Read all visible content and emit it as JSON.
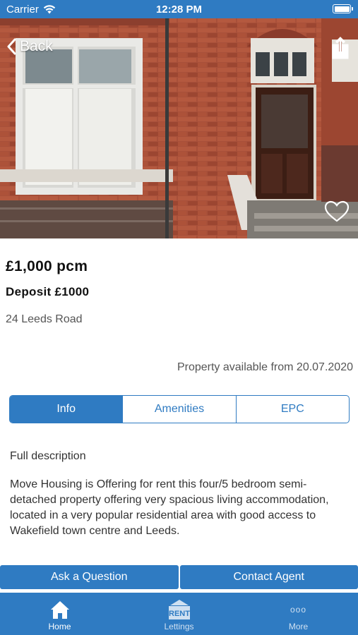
{
  "status_bar": {
    "carrier": "Carrier",
    "time": "12:28 PM",
    "wifi_icon": "wifi-icon",
    "battery_icon": "battery-icon"
  },
  "hero": {
    "back_label": "Back",
    "share_icon": "share-icon",
    "favorite_icon": "heart-icon"
  },
  "listing": {
    "price": "£1,000 pcm",
    "deposit": "Deposit £1000",
    "address": "24 Leeds Road",
    "availability": "Property available from 20.07.2020"
  },
  "tabs": [
    {
      "label": "Info",
      "active": true
    },
    {
      "label": "Amenities",
      "active": false
    },
    {
      "label": "EPC",
      "active": false
    }
  ],
  "description": {
    "title": "Full description",
    "body": "Move Housing is Offering for rent this four/5 bedroom semi-detached property offering very spacious living accommodation, located in a very popular residential area with good access to Wakefield town centre and Leeds."
  },
  "actions": {
    "ask_question": "Ask a Question",
    "contact_agent": "Contact Agent"
  },
  "tab_bar": [
    {
      "label": "Home",
      "icon": "home-icon"
    },
    {
      "label": "Lettings",
      "icon": "rent-sign-icon",
      "icon_text": "RENT"
    },
    {
      "label": "More",
      "icon": "more-dots-icon",
      "icon_text": "ooo"
    }
  ],
  "colors": {
    "accent": "#2f7bc2",
    "brick": "#a14a35"
  }
}
